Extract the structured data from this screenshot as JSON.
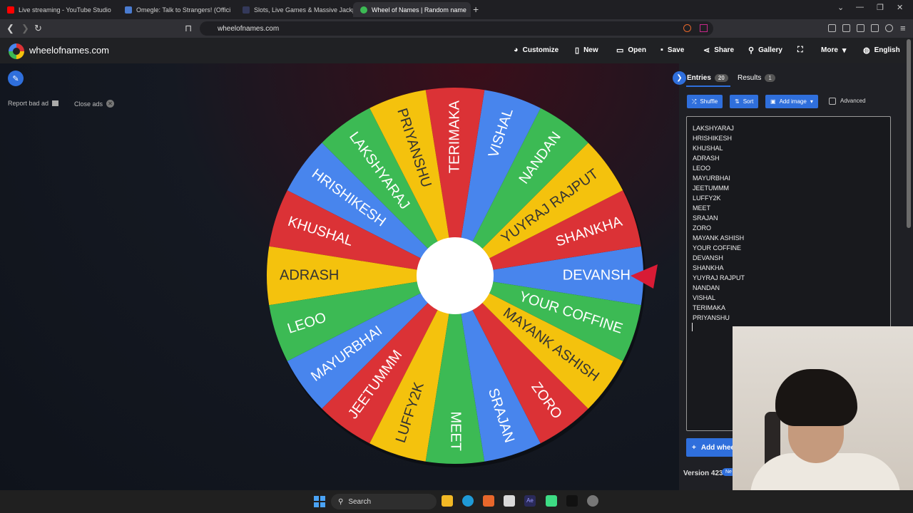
{
  "browser": {
    "tabs": [
      {
        "title": "Live streaming - YouTube Studio",
        "color": "#ff0000"
      },
      {
        "title": "Omegle: Talk to Strangers! (Offici",
        "color": "#4a7bd0"
      },
      {
        "title": "Slots, Live Games & Massive Jackpot",
        "color": "#34395a"
      },
      {
        "title": "Wheel of Names | Random name",
        "color": "#3cba54"
      }
    ],
    "url": "wheelofnames.com"
  },
  "site": {
    "name": "wheelofnames.com",
    "menu": [
      {
        "label": "Customize",
        "icon": "palette-icon"
      },
      {
        "label": "New",
        "icon": "file-icon"
      },
      {
        "label": "Open",
        "icon": "folder-icon"
      },
      {
        "label": "Save",
        "icon": "floppy-icon"
      },
      {
        "label": "Share",
        "icon": "share-icon"
      },
      {
        "label": "Gallery",
        "icon": "search-icon"
      },
      {
        "label": "",
        "icon": "fullscreen-icon"
      },
      {
        "label": "More",
        "icon": "chevron-down-icon"
      },
      {
        "label": "English",
        "icon": "globe-icon"
      }
    ]
  },
  "ads": {
    "report": "Report bad ad",
    "close": "Close ads"
  },
  "wheel": {
    "colors": [
      "#4885ed",
      "#db3236",
      "#f4c20d",
      "#3cba54"
    ],
    "segments": [
      "DEVANSH",
      "SHANKHA",
      "YUYRAJ RAJPUT",
      "NANDAN",
      "VISHAL",
      "TERIMAKA",
      "PRIYANSHU",
      "LAKSHYARAJ",
      "HRISHIKESH",
      "KHUSHAL",
      "ADRASH",
      "LEOO",
      "MAYURBHAI",
      "JEETUMMM",
      "LUFFY2K",
      "MEET",
      "SRAJAN",
      "ZORO",
      "MAYANK ASHISH",
      "YOUR COFFINE"
    ]
  },
  "panel": {
    "entries_tab": "Entries",
    "entries_count": "20",
    "results_tab": "Results",
    "results_count": "1",
    "shuffle": "Shuffle",
    "sort": "Sort",
    "add_image": "Add image",
    "advanced": "Advanced",
    "entries": [
      "LAKSHYARAJ",
      "HRISHIKESH",
      "KHUSHAL",
      "ADRASH",
      "LEOO",
      "MAYURBHAI",
      "JEETUMMM",
      "LUFFY2K",
      "MEET",
      "SRAJAN",
      "ZORO",
      "MAYANK ASHISH",
      "YOUR COFFINE",
      "DEVANSH",
      "SHANKHA",
      "YUYRAJ RAJPUT",
      "NANDAN",
      "VISHAL",
      "TERIMAKA",
      "PRIYANSHU"
    ],
    "add_wheel": "Add whee",
    "version": "Version 423",
    "new_badge": "Ne"
  },
  "taskbar": {
    "search": "Search"
  }
}
